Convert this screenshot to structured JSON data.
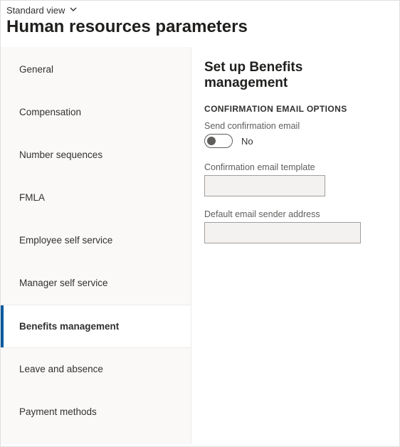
{
  "header": {
    "view_label": "Standard view",
    "page_title": "Human resources parameters"
  },
  "sidebar": {
    "items": [
      {
        "label": "General",
        "selected": false
      },
      {
        "label": "Compensation",
        "selected": false
      },
      {
        "label": "Number sequences",
        "selected": false
      },
      {
        "label": "FMLA",
        "selected": false
      },
      {
        "label": "Employee self service",
        "selected": false
      },
      {
        "label": "Manager self service",
        "selected": false
      },
      {
        "label": "Benefits management",
        "selected": true
      },
      {
        "label": "Leave and absence",
        "selected": false
      },
      {
        "label": "Payment methods",
        "selected": false
      }
    ]
  },
  "main": {
    "panel_title": "Set up Benefits management",
    "section_label": "CONFIRMATION EMAIL OPTIONS",
    "send_confirmation_label": "Send confirmation email",
    "send_confirmation_value": "No",
    "confirmation_template_label": "Confirmation email template",
    "confirmation_template_value": "",
    "default_sender_label": "Default email sender address",
    "default_sender_value": ""
  }
}
